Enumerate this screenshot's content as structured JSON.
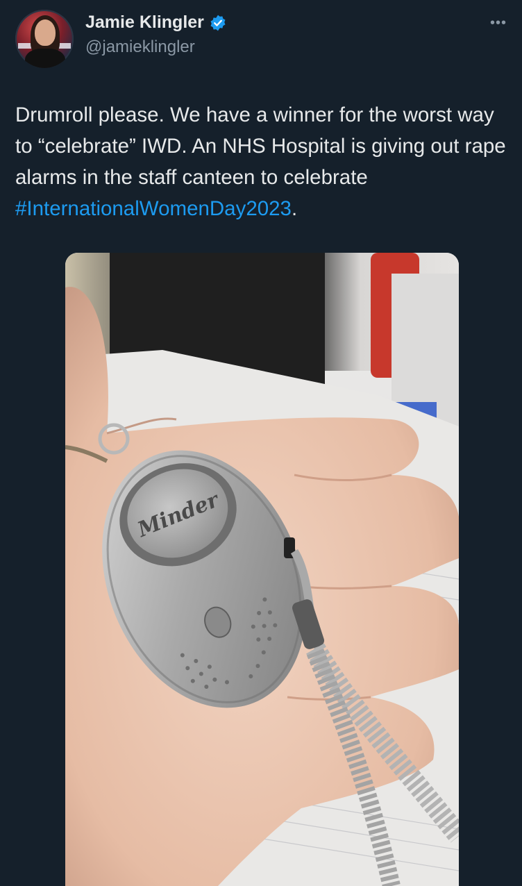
{
  "author": {
    "display_name": "Jamie Klingler",
    "handle": "@jamieklingler",
    "verified": true
  },
  "menu": {
    "more_label": "•••"
  },
  "tweet": {
    "text_before_hashtag": "Drumroll please.  We have a winner for the worst way to “celebrate” IWD. An NHS Hospital is giving out rape alarms in the staff canteen to celebrate ",
    "hashtag": "#InternationalWomenDay2023",
    "text_after_hashtag": "."
  },
  "media": {
    "logo_text": "Minder"
  },
  "colors": {
    "background": "#15202b",
    "text": "#e7e9ea",
    "secondary_text": "#8b98a5",
    "link": "#1d9bf0",
    "verified_badge": "#1d9bf0"
  }
}
